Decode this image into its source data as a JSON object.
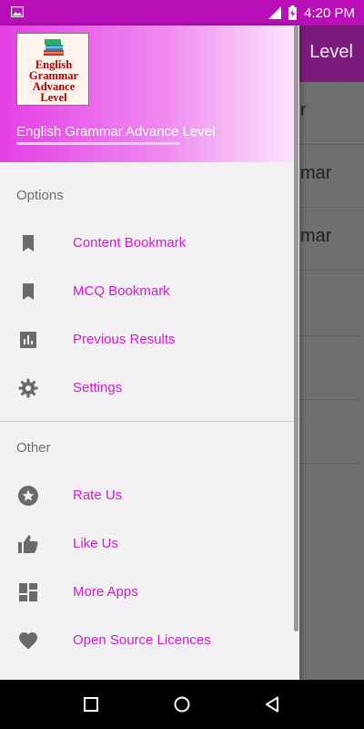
{
  "status_bar": {
    "time": "4:20 PM",
    "icons": [
      "image-icon",
      "signal-icon",
      "battery-icon"
    ]
  },
  "background_app": {
    "title": "Level",
    "rows": [
      "r",
      "mar",
      "mar"
    ]
  },
  "drawer": {
    "logo_text": "English Grammar Advance Level",
    "app_name": "English Grammar Advance Level",
    "sections": [
      {
        "label": "Options",
        "items": [
          {
            "label": "Content Bookmark",
            "icon": "bookmark-icon"
          },
          {
            "label": "MCQ Bookmark",
            "icon": "bookmark-icon"
          },
          {
            "label": "Previous Results",
            "icon": "bar-chart-icon"
          },
          {
            "label": "Settings",
            "icon": "gear-icon"
          }
        ]
      },
      {
        "label": "Other",
        "items": [
          {
            "label": "Rate Us",
            "icon": "star-circle-icon"
          },
          {
            "label": "Like Us",
            "icon": "thumbs-up-icon"
          },
          {
            "label": "More Apps",
            "icon": "dashboard-icon"
          },
          {
            "label": "Open Source Licences",
            "icon": "heart-icon"
          }
        ]
      }
    ]
  },
  "nav_bar": {
    "buttons": [
      "recents-button",
      "home-button",
      "back-button"
    ]
  },
  "colors": {
    "accent": "#d31ad3",
    "status_bar": "#b80fb8",
    "app_bar": "#7d1a7d",
    "icon": "#6a6a6a"
  }
}
